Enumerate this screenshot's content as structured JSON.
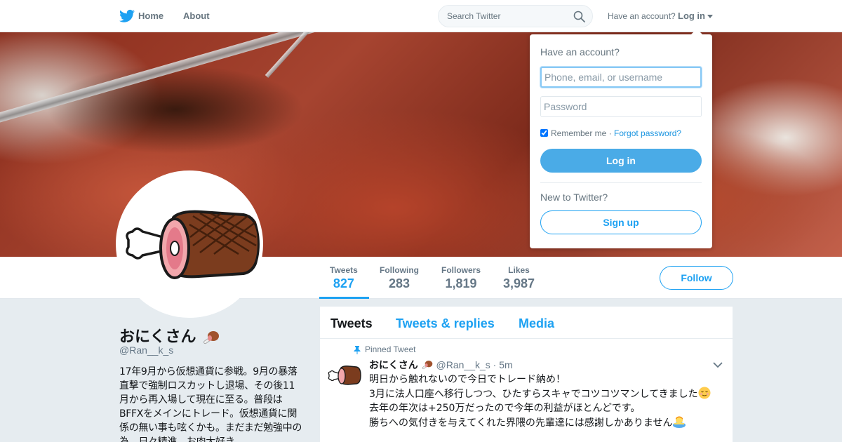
{
  "nav": {
    "logo": "twitter-bird-icon",
    "home_label": "Home",
    "about_label": "About",
    "search_placeholder": "Search Twitter",
    "account_prompt": "Have an account?",
    "login_label": "Log in"
  },
  "profile": {
    "name": "おにくさん",
    "handle": "@Ran__k_s",
    "bio": "17年9月から仮想通貨に参戦。9月の暴落直撃で強制ロスカットし退場、その後11月から再入場して現在に至る。普段はBFFXをメインにトレード。仮想通貨に関係の無い事も呟くかも。まだまだ勉強中の為、日々精進。お肉大好き。",
    "follow_label": "Follow"
  },
  "stats": [
    {
      "label": "Tweets",
      "value": "827"
    },
    {
      "label": "Following",
      "value": "283"
    },
    {
      "label": "Followers",
      "value": "1,819"
    },
    {
      "label": "Likes",
      "value": "3,987"
    }
  ],
  "timeline": {
    "tabs": [
      "Tweets",
      "Tweets & replies",
      "Media"
    ],
    "pinned_label": "Pinned Tweet",
    "tweet": {
      "author": "おにくさん",
      "handle_time": "@Ran__k_s · 5m",
      "lines": [
        "明日から触れないので今日でトレード納め！",
        "3月に法人口座へ移行しつつ、ひたすらスキャでコツコツマンしてきました",
        "去年の年次は+250万だったので今年の利益がほとんどです。",
        "勝ちへの気付きを与えてくれた界隈の先輩達には感謝しかありません"
      ]
    }
  },
  "login_card": {
    "title": "Have an account?",
    "username_placeholder": "Phone, email, or username",
    "password_placeholder": "Password",
    "remember_label": "Remember me",
    "separator": " · ",
    "forgot_label": "Forgot password?",
    "login_button": "Log in",
    "new_prompt": "New to Twitter?",
    "signup_button": "Sign up"
  },
  "colors": {
    "accent": "#1da1f2",
    "background": "#e6ecf0",
    "login_button": "#4aabe7"
  }
}
